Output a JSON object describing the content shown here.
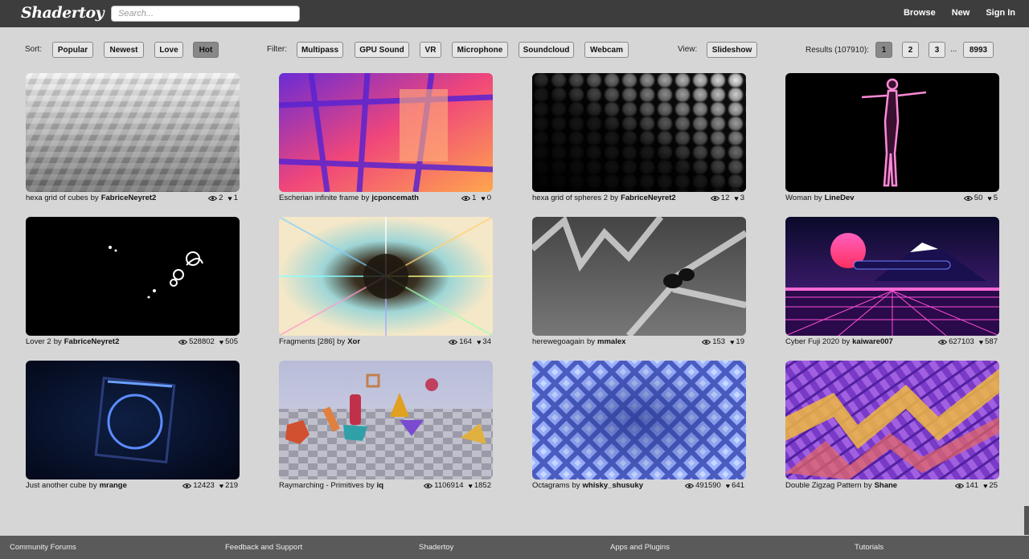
{
  "header": {
    "logo": "Shadertoy",
    "search_placeholder": "Search...",
    "nav": [
      "Browse",
      "New",
      "Sign In"
    ]
  },
  "toolbar": {
    "sort_label": "Sort:",
    "sort_options": [
      "Popular",
      "Newest",
      "Love",
      "Hot"
    ],
    "sort_active": "Hot",
    "filter_label": "Filter:",
    "filter_options": [
      "Multipass",
      "GPU Sound",
      "VR",
      "Microphone",
      "Soundcloud",
      "Webcam"
    ],
    "view_label": "View:",
    "view_option": "Slideshow",
    "results_label": "Results (107910):",
    "pages": [
      "1",
      "2",
      "3"
    ],
    "ellipsis": "...",
    "last_page": "8993",
    "active_page": "1"
  },
  "shaders": [
    {
      "title": "hexa grid of cubes",
      "author": "FabriceNeyret2",
      "views": "2",
      "likes": "1"
    },
    {
      "title": "Escherian infinite frame",
      "author": "jcponcemath",
      "views": "1",
      "likes": "0"
    },
    {
      "title": "hexa grid of spheres 2",
      "author": "FabriceNeyret2",
      "views": "12",
      "likes": "3"
    },
    {
      "title": "Woman",
      "author": "LineDev",
      "views": "50",
      "likes": "5"
    },
    {
      "title": "Lover 2",
      "author": "FabriceNeyret2",
      "views": "528802",
      "likes": "505"
    },
    {
      "title": "Fragments [286]",
      "author": "Xor",
      "views": "164",
      "likes": "34"
    },
    {
      "title": "herewegoagain",
      "author": "mmalex",
      "views": "153",
      "likes": "19"
    },
    {
      "title": "Cyber Fuji 2020",
      "author": "kaiware007",
      "views": "627103",
      "likes": "587"
    },
    {
      "title": "Just another cube",
      "author": "mrange",
      "views": "12423",
      "likes": "219"
    },
    {
      "title": "Raymarching - Primitives",
      "author": "iq",
      "views": "1106914",
      "likes": "1852"
    },
    {
      "title": "Octagrams",
      "author": "whisky_shusuky",
      "views": "491590",
      "likes": "641"
    },
    {
      "title": "Double Zigzag Pattern",
      "author": "Shane",
      "views": "141",
      "likes": "25"
    }
  ],
  "by_word": "by",
  "heart_glyph": "♥",
  "footer": [
    "Community Forums",
    "Feedback and Support",
    "Shadertoy",
    "Apps and Plugins",
    "Tutorials"
  ]
}
